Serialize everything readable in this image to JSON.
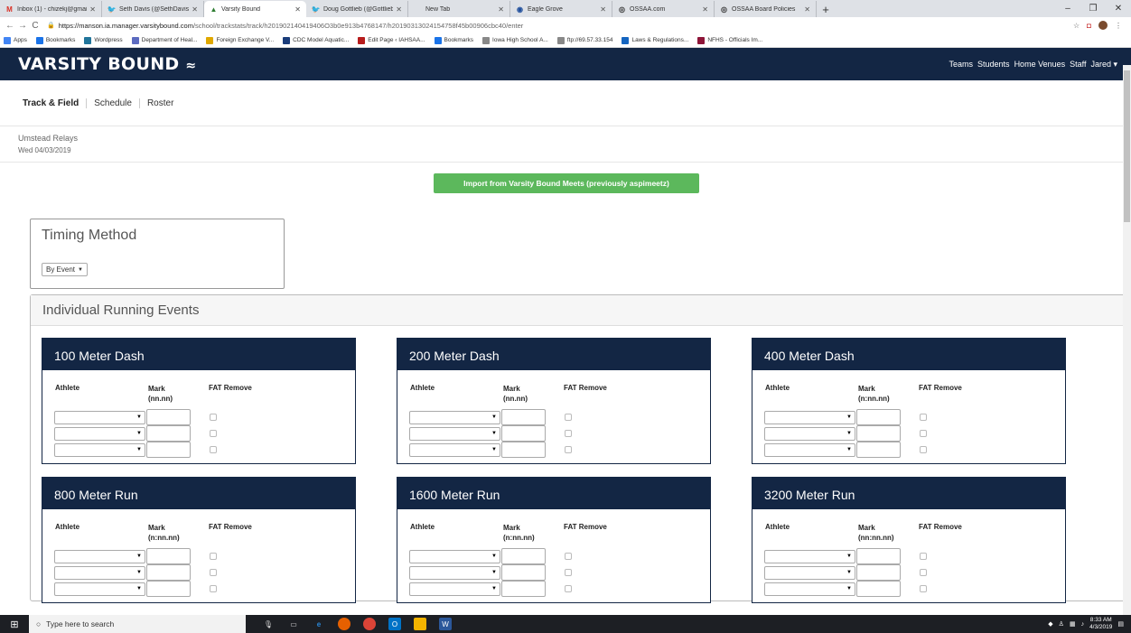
{
  "browser": {
    "tabs": [
      {
        "label": "Inbox (1) - chizekj@gmail.c",
        "icon": "gmail-icon",
        "color": "#d93025",
        "glyph": "M"
      },
      {
        "label": "Seth Davis (@SethDavisHoo",
        "icon": "twitter-icon",
        "color": "#1da1f2",
        "glyph": "🐦"
      },
      {
        "label": "Varsity Bound",
        "icon": "varsity-icon",
        "color": "#2e7d32",
        "glyph": "▲",
        "active": true
      },
      {
        "label": "Doug Gottlieb (@GottliebS",
        "icon": "twitter-icon",
        "color": "#1da1f2",
        "glyph": "🐦"
      },
      {
        "label": "New Tab",
        "icon": "newtab-icon",
        "color": "#777",
        "glyph": ""
      },
      {
        "label": "Eagle Grove",
        "icon": "eagle-icon",
        "color": "#1f4e9c",
        "glyph": "◉"
      },
      {
        "label": "OSSAA.com",
        "icon": "ossaa-icon",
        "color": "#333",
        "glyph": "◎"
      },
      {
        "label": "OSSAA Board Policies",
        "icon": "ossaa-icon",
        "color": "#333",
        "glyph": "◎"
      }
    ],
    "url_host": "https://manson.ia.manager.varsitybound.com",
    "url_path": "/school/trackstats/track/h201902140419406O3b0e913b4768147/h20190313024154758f45b00906cbc40/enter",
    "bookmarks": [
      {
        "label": "Apps",
        "color": "#4285f4"
      },
      {
        "label": "Bookmarks",
        "color": "#1a73e8"
      },
      {
        "label": "Wordpress",
        "color": "#21759b"
      },
      {
        "label": "Department of Heal...",
        "color": "#5c6bc0"
      },
      {
        "label": "Foreign Exchange V...",
        "color": "#e0a800"
      },
      {
        "label": "CDC Model Aquatic...",
        "color": "#1a3c7a"
      },
      {
        "label": "Edit Page ‹ IAHSAA...",
        "color": "#b71c1c"
      },
      {
        "label": "Bookmarks",
        "color": "#1a73e8"
      },
      {
        "label": "Iowa High School A...",
        "color": "#888"
      },
      {
        "label": "ftp://69.57.33.154",
        "color": "#888"
      },
      {
        "label": "Laws & Regulations...",
        "color": "#1565c0"
      },
      {
        "label": "NFHS - Officials Im...",
        "color": "#8e1538"
      }
    ]
  },
  "app": {
    "brand": "VARSITY BOUND",
    "nav": [
      "Teams",
      "Students",
      "Home Venues",
      "Staff",
      "Jared ▾"
    ],
    "subnav": [
      "Track & Field",
      "Schedule",
      "Roster"
    ],
    "meet_name": "Umstead Relays",
    "meet_date": "Wed 04/03/2019",
    "import_button": "Import from Varsity Bound Meets (previously aspimeetz)",
    "timing_title": "Timing Method",
    "timing_value": "By Event",
    "section_title": "Individual Running Events",
    "columns": {
      "athlete": "Athlete",
      "mark": "Mark",
      "fat": "FAT Remove"
    },
    "events": [
      {
        "name": "100 Meter Dash",
        "format": "(nn.nn)"
      },
      {
        "name": "200 Meter Dash",
        "format": "(nn.nn)"
      },
      {
        "name": "400 Meter Dash",
        "format": "(n:nn.nn)"
      },
      {
        "name": "800 Meter Run",
        "format": "(n:nn.nn)"
      },
      {
        "name": "1600 Meter Run",
        "format": "(n:nn.nn)"
      },
      {
        "name": "3200 Meter Run",
        "format": "(nn:nn.nn)"
      }
    ]
  },
  "taskbar": {
    "search_placeholder": "Type here to search",
    "time": "8:33 AM",
    "date": "4/3/2019"
  }
}
